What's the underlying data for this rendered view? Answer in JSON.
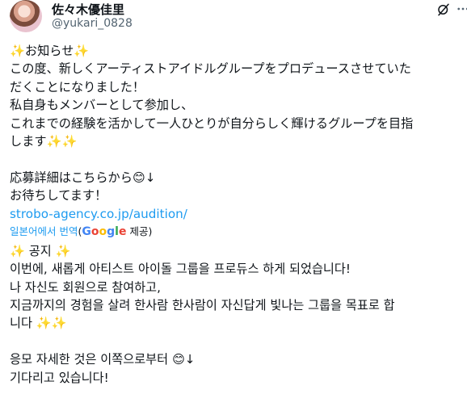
{
  "author": {
    "display_name": "佐々木優佳里",
    "handle": "@yukari_0828"
  },
  "icons": {
    "grok": "grok-icon",
    "more": "more-icon",
    "sparkle": "✨",
    "smile": "😊",
    "arrow": "↓"
  },
  "original": {
    "lines": [
      "✨お知らせ✨",
      "この度、新しくアーティストアイドルグループをプロデュースさせていた",
      "だくことになりました！",
      "私自身もメンバーとして参加し、",
      "これまでの経験を活かして一人ひとりが自分らしく輝けるグループを目指",
      "します✨✨",
      "",
      "応募詳細はこちらから😊↓",
      "お待ちしてます！"
    ],
    "link": "strobo-agency.co.jp/audition/"
  },
  "translation": {
    "link_text": "일본어에서 번역",
    "paren_open": "(",
    "google": "Google",
    "provided": " 제공)",
    "lines": [
      "✨ 공지 ✨",
      "이번에, 새롭게 아티스트 아이돌 그룹을 프로듀스 하게 되었습니다!",
      "나 자신도 회원으로 참여하고,",
      "지금까지의 경험을 살려 한사람 한사람이 자신답게 빛나는 그룹을 목표로 합",
      "니다 ✨✨",
      "",
      "응모 자세한 것은 이쪽으로부터 😊↓",
      "기다리고 있습니다!"
    ]
  }
}
